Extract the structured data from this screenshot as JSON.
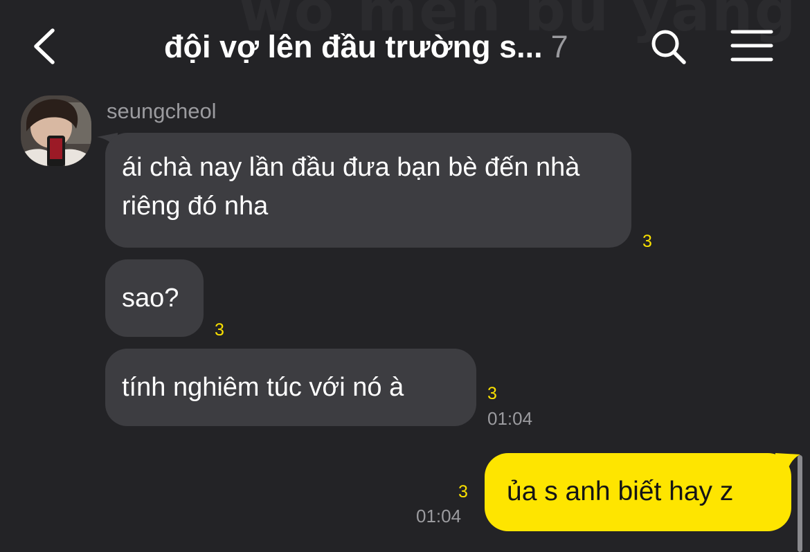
{
  "watermark": "wo men bu yang",
  "header": {
    "title": "đội vợ lên đầu trường s...",
    "member_count": "7",
    "back_icon": "chevron-left-icon",
    "search_icon": "search-icon",
    "menu_icon": "menu-icon"
  },
  "colors": {
    "background": "#232326",
    "incoming_bubble": "#3d3d41",
    "outgoing_bubble": "#fee500",
    "unread": "#f9e000",
    "meta_text": "#9b9b9f"
  },
  "messages": {
    "sender": "seungcheol",
    "incoming": [
      {
        "text": "ái chà nay lần đầu đưa bạn bè đến nhà riêng đó nha",
        "unread": "3",
        "time": ""
      },
      {
        "text": "sao?",
        "unread": "3",
        "time": ""
      },
      {
        "text": "tính nghiêm túc với nó à",
        "unread": "3",
        "time": "01:04"
      }
    ],
    "outgoing": [
      {
        "text": "ủa s anh biết hay z",
        "unread": "3",
        "time": "01:04"
      }
    ]
  }
}
